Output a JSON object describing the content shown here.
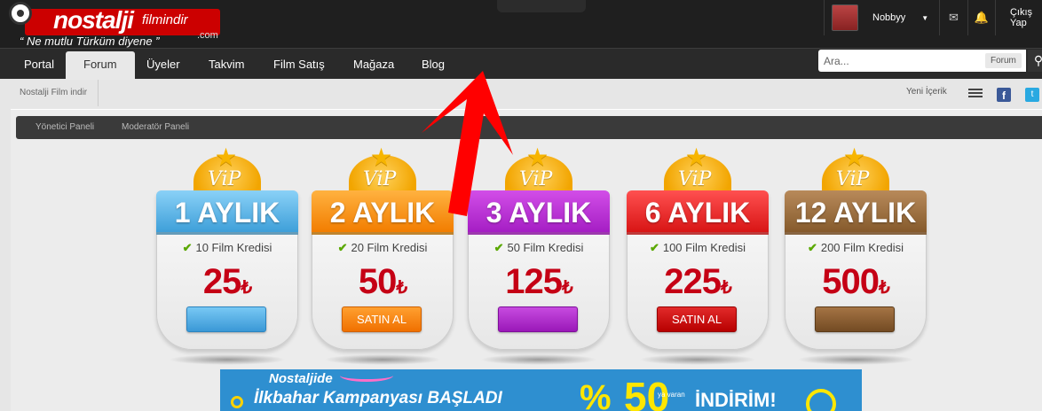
{
  "header": {
    "logo_text": "nostalji",
    "logo_sub": "filmindir",
    "logo_com": ".com",
    "slogan": "“ Ne mutlu Türküm diyene ”",
    "username": "Nobbyy",
    "logout": "Çıkış Yap"
  },
  "nav": {
    "items": [
      "Portal",
      "Forum",
      "Üyeler",
      "Takvim",
      "Film Satış",
      "Mağaza",
      "Blog"
    ],
    "active": "Forum",
    "search_placeholder": "Ara...",
    "search_scope": "Forum"
  },
  "breadcrumb": {
    "home": "Nostalji Film indir",
    "new_content": "Yeni İçerik"
  },
  "mod_bar": {
    "admin": "Yönetici Paneli",
    "moderator": "Moderatör Paneli"
  },
  "plans": [
    {
      "badge": "ViP",
      "title": "1 AYLIK",
      "feature": "10 Film Kredisi",
      "price": "25",
      "currency": "₺",
      "button": "",
      "color": "#3e9fd9"
    },
    {
      "badge": "ViP",
      "title": "2 AYLIK",
      "feature": "20 Film Kredisi",
      "price": "50",
      "currency": "₺",
      "button": "SATIN AL",
      "color": "#f27d00"
    },
    {
      "badge": "ViP",
      "title": "3 AYLIK",
      "feature": "50 Film Kredisi",
      "price": "125",
      "currency": "₺",
      "button": "",
      "color": "#a51ec4"
    },
    {
      "badge": "ViP",
      "title": "6 AYLIK",
      "feature": "100 Film Kredisi",
      "price": "225",
      "currency": "₺",
      "button": "SATIN AL",
      "color": "#d81515"
    },
    {
      "badge": "ViP",
      "title": "12 AYLIK",
      "feature": "200 Film Kredisi",
      "price": "500",
      "currency": "₺",
      "button": "",
      "color": "#855a2c"
    }
  ],
  "banner": {
    "line1": "Nostaljide",
    "line2": "İlkbahar Kampanyası BAŞLADI",
    "percent": "%",
    "amount": "50",
    "small": "ya varan",
    "discount": "İNDİRİM!"
  },
  "icons": {
    "message": "envelope-icon",
    "notifications": "bell-icon",
    "search": "magnifier-icon",
    "list": "list-icon",
    "facebook": "facebook-icon",
    "twitter": "twitter-icon"
  }
}
